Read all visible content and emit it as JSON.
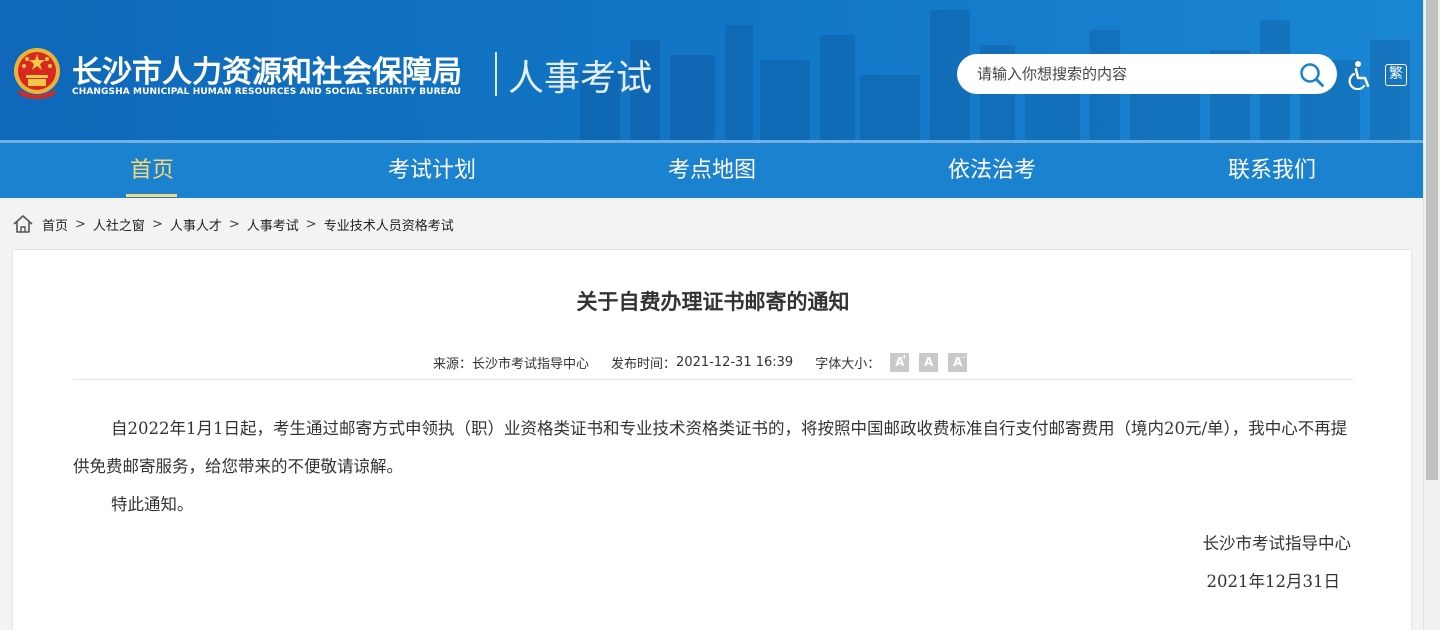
{
  "header": {
    "org_name": "长沙市人力资源和社会保障局",
    "org_name_en": "CHANGSHA MUNICIPAL HUMAN RESOURCES AND SOCIAL SECURITY BUREAU",
    "section": "人事考试",
    "search_placeholder": "请输入你想搜索的内容",
    "traditional_label": "繁",
    "accent_color": "#1277c7"
  },
  "nav": {
    "items": [
      {
        "label": "首页",
        "active": true
      },
      {
        "label": "考试计划",
        "active": false
      },
      {
        "label": "考点地图",
        "active": false
      },
      {
        "label": "依法治考",
        "active": false
      },
      {
        "label": "联系我们",
        "active": false
      }
    ],
    "active_color": "#f6d77a"
  },
  "breadcrumb": {
    "items": [
      "首页",
      "人社之窗",
      "人事人才",
      "人事考试",
      "专业技术人员资格考试"
    ],
    "separator": ">"
  },
  "article": {
    "title": "关于自费办理证书邮寄的通知",
    "source_label": "来源：",
    "source": "长沙市考试指导中心",
    "published_label": "发布时间：",
    "published": "2021-12-31 16:39",
    "font_size_label": "字体大小：",
    "font_buttons": [
      "A",
      "A",
      "A"
    ],
    "paragraphs": [
      "自2022年1月1日起，考生通过邮寄方式申领执（职）业资格类证书和专业技术资格类证书的，将按照中国邮政收费标准自行支付邮寄费用（境内20元/单），我中心不再提供免费邮寄服务，给您带来的不便敬请谅解。",
      "特此通知。"
    ],
    "signature": "长沙市考试指导中心",
    "date": "2021年12月31日"
  }
}
